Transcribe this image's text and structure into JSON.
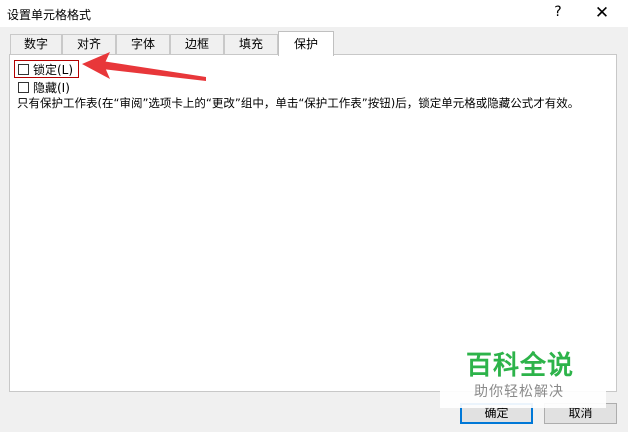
{
  "window": {
    "title": "设置单元格格式",
    "help_glyph": "?",
    "close_glyph": "✕"
  },
  "tabs": [
    {
      "label": "数字",
      "active": false
    },
    {
      "label": "对齐",
      "active": false
    },
    {
      "label": "字体",
      "active": false
    },
    {
      "label": "边框",
      "active": false
    },
    {
      "label": "填充",
      "active": false
    },
    {
      "label": "保护",
      "active": true
    }
  ],
  "protection": {
    "locked": {
      "label": "锁定(L)",
      "checked": false
    },
    "hidden": {
      "label": "隐藏(I)",
      "checked": false
    },
    "description": "只有保护工作表(在“审阅”选项卡上的“更改”组中，单击“保护工作表”按钮)后，锁定单元格或隐藏公式才有效。"
  },
  "buttons": {
    "ok": "确定",
    "cancel": "取消"
  },
  "watermark": {
    "main": "百科全说",
    "sub": "助你轻松解决"
  },
  "colors": {
    "annotation_arrow": "#e8373a",
    "watermark_green": "#2db34a"
  }
}
